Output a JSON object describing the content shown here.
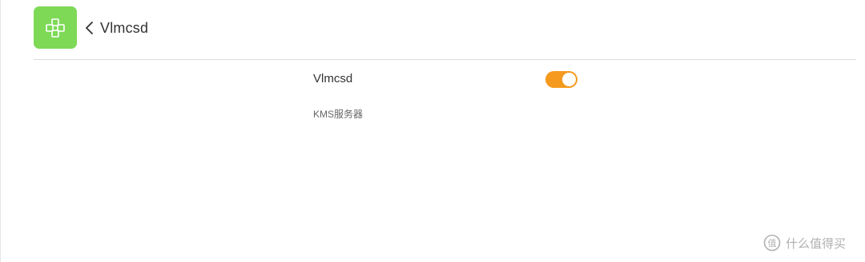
{
  "app": {
    "icon": "puzzle-cross-icon",
    "accent_color": "#7ed957"
  },
  "header": {
    "back_icon": "chevron-left-icon",
    "title": "Vlmcsd"
  },
  "setting": {
    "label": "Vlmcsd",
    "enabled": true,
    "toggle_color": "#f59a1e",
    "description": "KMS服务器"
  },
  "watermark": {
    "logo": "smzdm-logo",
    "text": "什么值得买"
  }
}
